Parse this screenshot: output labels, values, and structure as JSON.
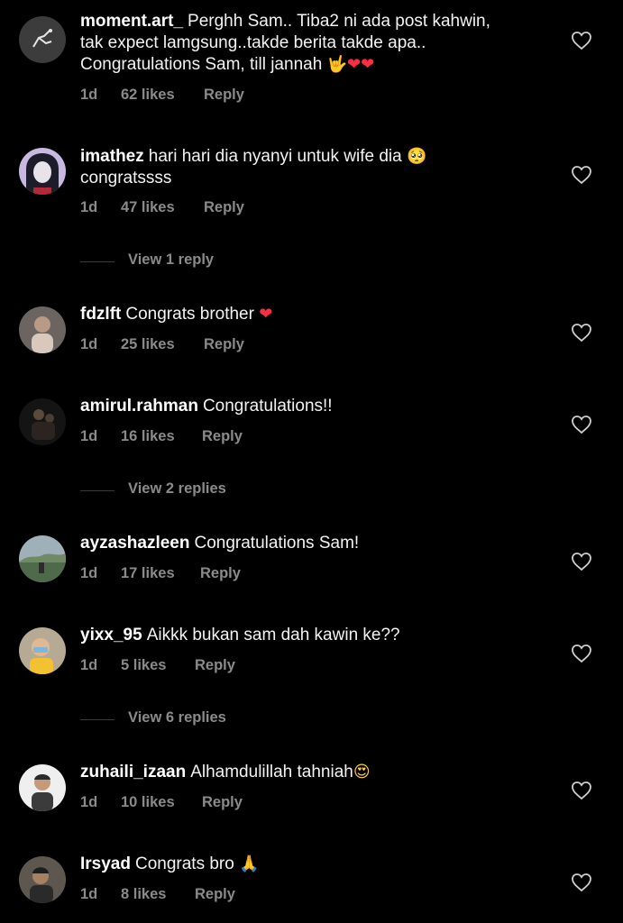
{
  "comments": [
    {
      "username": "moment.art_",
      "text_lines": [
        "Perghh Sam.. Tiba2 ni ada post kahwin,",
        "tak expect lamgsung..takde berita takde apa..",
        "Congratulations Sam, till jannah"
      ],
      "emojis": [
        "🤟",
        "❤",
        "❤"
      ],
      "time": "1d",
      "likes": "62 likes",
      "reply": "Reply",
      "avatar_icon": "hand-sketch-avatar"
    },
    {
      "username": "imathez",
      "text_lines": [
        "hari hari dia nyanyi untuk wife dia",
        "congratssss"
      ],
      "emojis": [
        "🥺"
      ],
      "time": "1d",
      "likes": "47 likes",
      "reply": "Reply",
      "avatar_icon": "cartoon-girl-avatar"
    },
    {
      "username": "fdzlft",
      "text_lines": [
        "Congrats brother"
      ],
      "emojis": [
        "❤"
      ],
      "time": "1d",
      "likes": "25 likes",
      "reply": "Reply",
      "avatar_icon": "photo-avatar"
    },
    {
      "username": "amirul.rahman",
      "text_lines": [
        "Congratulations!!"
      ],
      "emojis": [],
      "time": "1d",
      "likes": "16 likes",
      "reply": "Reply",
      "avatar_icon": "dark-photo-avatar"
    },
    {
      "username": "ayzashazleen",
      "text_lines": [
        "Congratulations Sam!"
      ],
      "emojis": [],
      "time": "1d",
      "likes": "17 likes",
      "reply": "Reply",
      "avatar_icon": "landscape-avatar"
    },
    {
      "username": "yixx_95",
      "text_lines": [
        "Aikkk bukan sam dah kawin ke??"
      ],
      "emojis": [],
      "time": "1d",
      "likes": "5 likes",
      "reply": "Reply",
      "avatar_icon": "child-photo-avatar"
    },
    {
      "username": "zuhaili_izaan",
      "text_lines": [
        "Alhamdulillah tahniah"
      ],
      "emojis": [
        "😍"
      ],
      "time": "1d",
      "likes": "10 likes",
      "reply": "Reply",
      "avatar_icon": "man-photo-avatar"
    },
    {
      "username": "Irsyad",
      "text_lines": [
        "Congrats bro"
      ],
      "emojis": [
        "🙏"
      ],
      "time": "1d",
      "likes": "8 likes",
      "reply": "Reply",
      "avatar_icon": "man-photo-avatar"
    }
  ],
  "view_replies": [
    "View 1 reply",
    "View 2 replies",
    "View 6 replies"
  ],
  "colors": {
    "background": "#000000",
    "text": "#f2f2f2",
    "meta": "#8a8a8a",
    "heart_emoji": "#ff2d41",
    "divider": "#3a3a3a"
  },
  "icons": {
    "like": "heart-outline-icon"
  }
}
